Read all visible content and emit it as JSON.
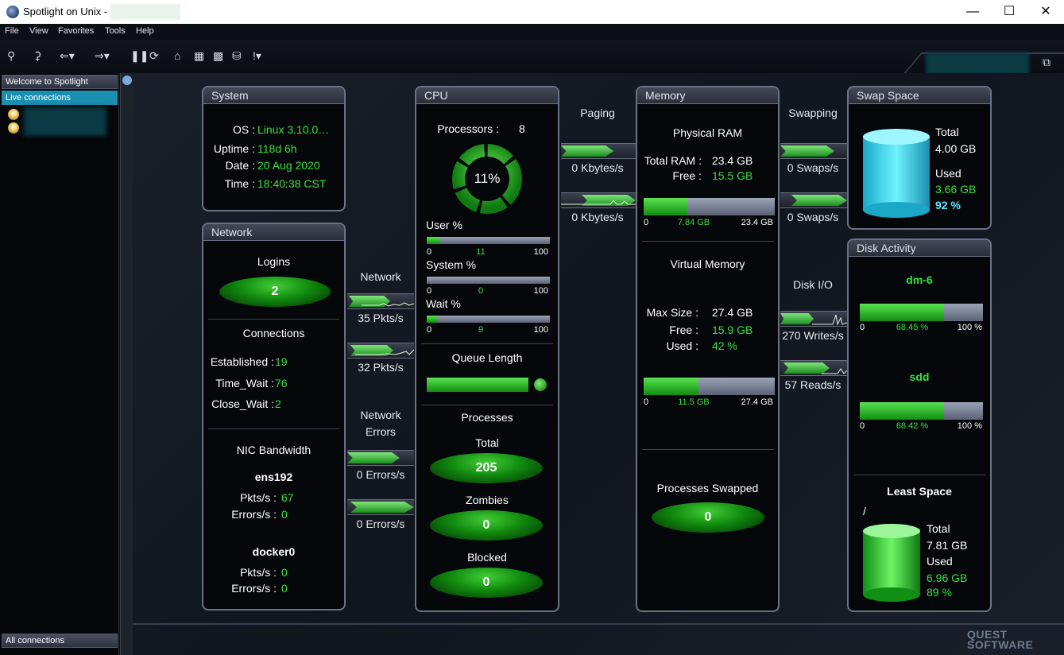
{
  "window": {
    "title": "Spotlight on Unix -"
  },
  "menu": {
    "file": "File",
    "view": "View",
    "favorites": "Favorites",
    "tools": "Tools",
    "help": "Help"
  },
  "sidebar": {
    "welcome": "Welcome to Spotlight",
    "live": "Live connections",
    "all": "All connections"
  },
  "system": {
    "title": "System",
    "os_label": "OS :",
    "os_value": "Linux  3.10.0…",
    "uptime_label": "Uptime :",
    "uptime_value": "118d 6h",
    "date_label": "Date :",
    "date_value": "20 Aug 2020",
    "time_label": "Time :",
    "time_value": "18:40:38 CST"
  },
  "network": {
    "title": "Network",
    "logins_label": "Logins",
    "logins_value": "2",
    "connections_label": "Connections",
    "established_label": "Established :",
    "established_value": "19",
    "timewait_label": "Time_Wait :",
    "timewait_value": "76",
    "closewait_label": "Close_Wait :",
    "closewait_value": "2",
    "nic_label": "NIC Bandwidth",
    "nic1": {
      "name": "ens192",
      "pkts_label": "Pkts/s :",
      "pkts_value": "67",
      "err_label": "Errors/s :",
      "err_value": "0"
    },
    "nic2": {
      "name": "docker0",
      "pkts_label": "Pkts/s :",
      "pkts_value": "0",
      "err_label": "Errors/s :",
      "err_value": "0"
    }
  },
  "net_flow": {
    "label": "Network",
    "in": "35 Pkts/s",
    "out": "32 Pkts/s",
    "errors_label1": "Network",
    "errors_label2": "Errors",
    "err_in": "0 Errors/s",
    "err_out": "0 Errors/s"
  },
  "cpu": {
    "title": "CPU",
    "processors_label": "Processors :",
    "processors_value": "8",
    "usage": "11%",
    "usage_fraction": 0.11,
    "user_label": "User %",
    "user_min": "0",
    "user_value": "11",
    "user_max": "100",
    "user_fraction": 0.11,
    "system_label": "System %",
    "system_min": "0",
    "system_value": "0",
    "system_max": "100",
    "system_fraction": 0.0,
    "wait_label": "Wait %",
    "wait_min": "0",
    "wait_value": "9",
    "wait_max": "100",
    "wait_fraction": 0.09,
    "queue_label": "Queue Length",
    "processes_label": "Processes",
    "total_label": "Total",
    "total_value": "205",
    "zombies_label": "Zombies",
    "zombies_value": "0",
    "blocked_label": "Blocked",
    "blocked_value": "0"
  },
  "paging": {
    "label": "Paging",
    "in": "0 Kbytes/s",
    "out": "0 Kbytes/s"
  },
  "memory": {
    "title": "Memory",
    "physical_label": "Physical RAM",
    "total_label": "Total RAM :",
    "total_value": "23.4 GB",
    "free_label": "Free :",
    "free_value": "15.5 GB",
    "phys_min": "0",
    "phys_used": "7.84 GB",
    "phys_max": "23.4 GB",
    "phys_fraction": 0.335,
    "virtual_label": "Virtual Memory",
    "max_label": "Max Size :",
    "max_value": "27.4 GB",
    "vfree_label": "Free :",
    "vfree_value": "15.9 GB",
    "vused_label": "Used :",
    "vused_value": "42 %",
    "virt_min": "0",
    "virt_used": "11.5 GB",
    "virt_max": "27.4 GB",
    "virt_fraction": 0.42,
    "swapped_label": "Processes Swapped",
    "swapped_value": "0"
  },
  "swapping": {
    "label": "Swapping",
    "in": "0 Swaps/s",
    "out": "0 Swaps/s"
  },
  "diskio": {
    "label": "Disk I/O",
    "writes": "270 Writes/s",
    "reads": "57 Reads/s"
  },
  "swap": {
    "title": "Swap Space",
    "total_label": "Total",
    "total_value": "4.00 GB",
    "used_label": "Used",
    "used_value": "3.66 GB",
    "used_pct": "92 %",
    "used_fraction": 0.92
  },
  "disk": {
    "title": "Disk Activity",
    "d1": {
      "name": "dm-6",
      "min": "0",
      "value": "68.45 %",
      "max": "100 %",
      "fraction": 0.6845
    },
    "d2": {
      "name": "sdd",
      "min": "0",
      "value": "68.42 %",
      "max": "100 %",
      "fraction": 0.6842
    },
    "least_label": "Least Space",
    "mount": "/",
    "total_label": "Total",
    "total_value": "7.81 GB",
    "used_label": "Used",
    "used_value": "6.96 GB",
    "used_pct": "89 %",
    "used_fraction": 0.89
  },
  "branding": {
    "line1": "QUEST",
    "line2": "SOFTWARE"
  },
  "colors": {
    "accent_green": "#35e23a",
    "accent_cyan": "#5ee6ff",
    "sidebar_highlight": "#1a8fb0"
  }
}
